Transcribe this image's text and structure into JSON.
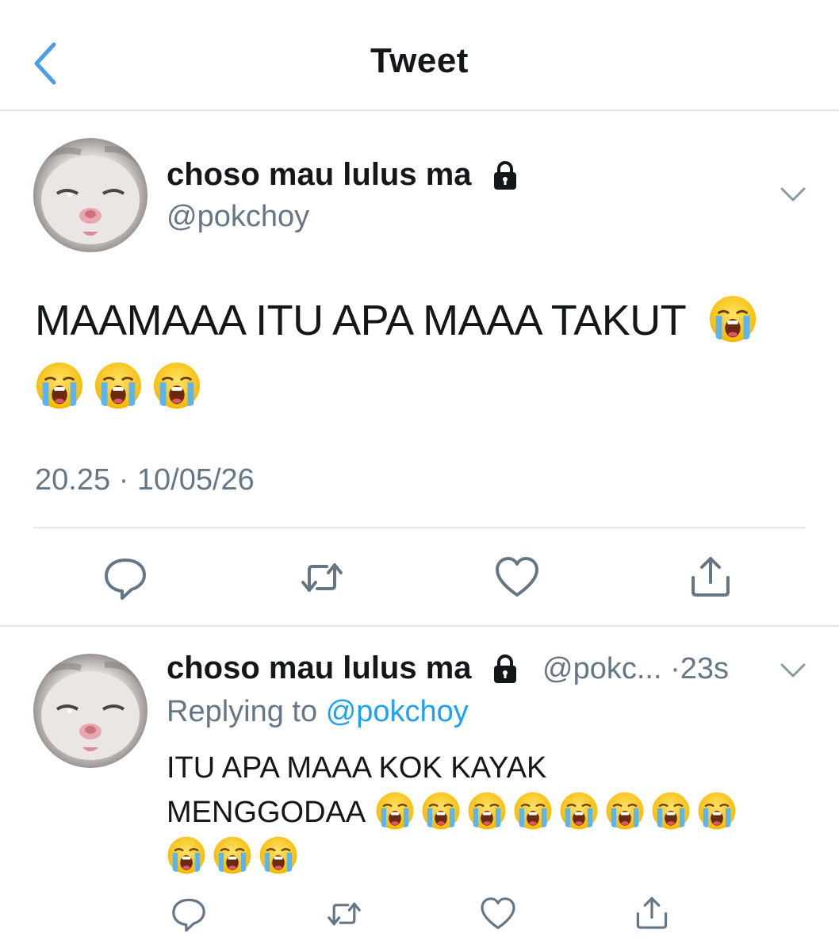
{
  "header": {
    "title": "Tweet",
    "back_icon": "chevron-left-icon"
  },
  "tweet": {
    "display_name": "choso mau lulus ma",
    "handle": "@pokchoy",
    "protected_icon": "lock-icon",
    "text": "MAAMAAA ITU APA MAAA TAKUT",
    "emoji": "loudly-crying-face",
    "emoji_count": 4,
    "timestamp": "20.25 · 10/05/26",
    "actions": [
      "reply-icon",
      "retweet-icon",
      "like-icon",
      "share-icon"
    ]
  },
  "reply": {
    "display_name": "choso mau lulus ma",
    "handle_truncated": "@pokc...",
    "time_sep": "·",
    "time": "23s",
    "replying_label": "Replying to",
    "replying_to": "@pokchoy",
    "text_line1": "ITU APA MAAA KOK KAYAK",
    "text_line2": "MENGGODAA",
    "emoji_count": 11,
    "actions": [
      "reply-icon",
      "retweet-icon",
      "like-icon",
      "share-icon"
    ]
  },
  "colors": {
    "accent": "#1da1f2",
    "back": "#4a9ee8",
    "muted": "#657786",
    "divider": "#e1e8ed",
    "text": "#14171a"
  }
}
